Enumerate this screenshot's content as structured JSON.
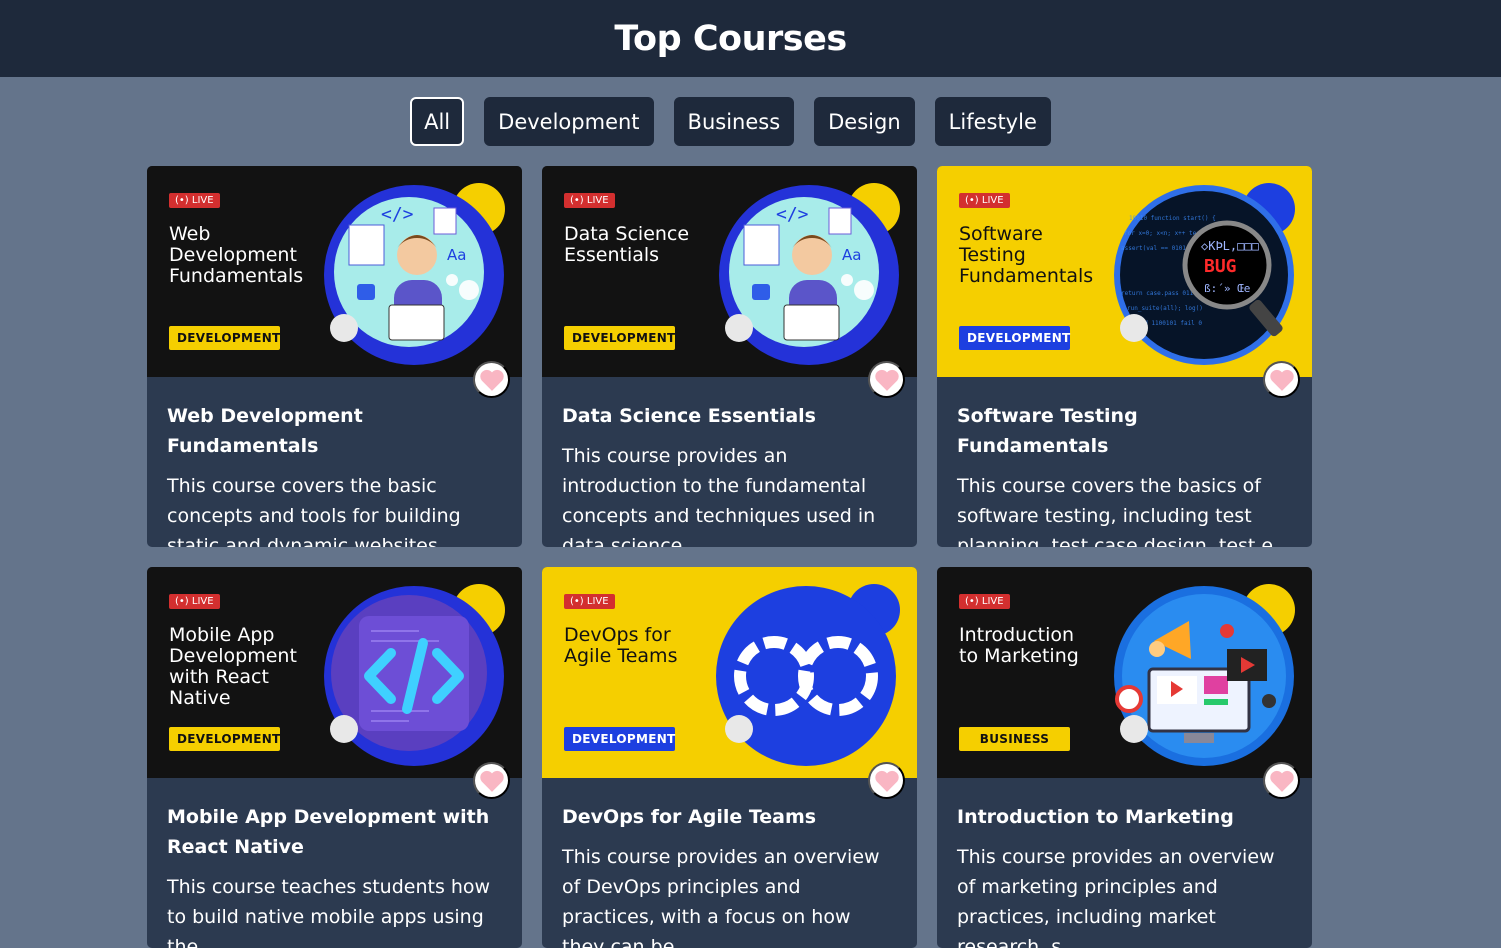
{
  "header": {
    "title": "Top Courses"
  },
  "filters": [
    {
      "label": "All",
      "active": true
    },
    {
      "label": "Development",
      "active": false
    },
    {
      "label": "Business",
      "active": false
    },
    {
      "label": "Design",
      "active": false
    },
    {
      "label": "Lifestyle",
      "active": false
    }
  ],
  "live_label": "LIVE",
  "courses": [
    {
      "thumb_title": "Web Development Fundamentals",
      "category": "DEVELOPMENT",
      "title": "Web Development Fundamentals",
      "description": "This course covers the basic concepts and tools for building static and dynamic websites. Students w...",
      "theme": "dark"
    },
    {
      "thumb_title": "Data Science Essentials",
      "category": "DEVELOPMENT",
      "title": "Data Science Essentials",
      "description": "This course provides an introduction to the fundamental concepts and techniques used in data science...",
      "theme": "dark"
    },
    {
      "thumb_title": "Software Testing Fundamentals",
      "category": "DEVELOPMENT",
      "title": "Software Testing Fundamentals",
      "description": "This course covers the basics of software testing, including test planning, test case design, test e...",
      "theme": "yellow"
    },
    {
      "thumb_title": "Mobile App Development with React Native",
      "category": "DEVELOPMENT",
      "title": "Mobile App Development with React Native",
      "description": "This course teaches students how to build native mobile apps using the",
      "theme": "dark"
    },
    {
      "thumb_title": "DevOps for Agile Teams",
      "category": "DEVELOPMENT",
      "title": "DevOps for Agile Teams",
      "description": "This course provides an overview of DevOps principles and practices, with a focus on how they can be...",
      "theme": "yellow"
    },
    {
      "thumb_title": "Introduction to Marketing",
      "category": "BUSINESS",
      "title": "Introduction to Marketing",
      "description": "This course provides an overview of marketing principles and practices, including market research, s...",
      "theme": "dark"
    }
  ],
  "colors": {
    "page_bg": "#64748b",
    "header_bg": "#1e293b",
    "card_bg": "#2c3a50",
    "thumb_dark": "#121212",
    "thumb_yellow": "#f5cf00",
    "accent_blue": "#1d3fe0",
    "live_red": "#d32f2f",
    "heart_pink": "#f9b6c3"
  },
  "icons": {
    "heart": "heart-icon",
    "live": "broadcast-icon"
  }
}
